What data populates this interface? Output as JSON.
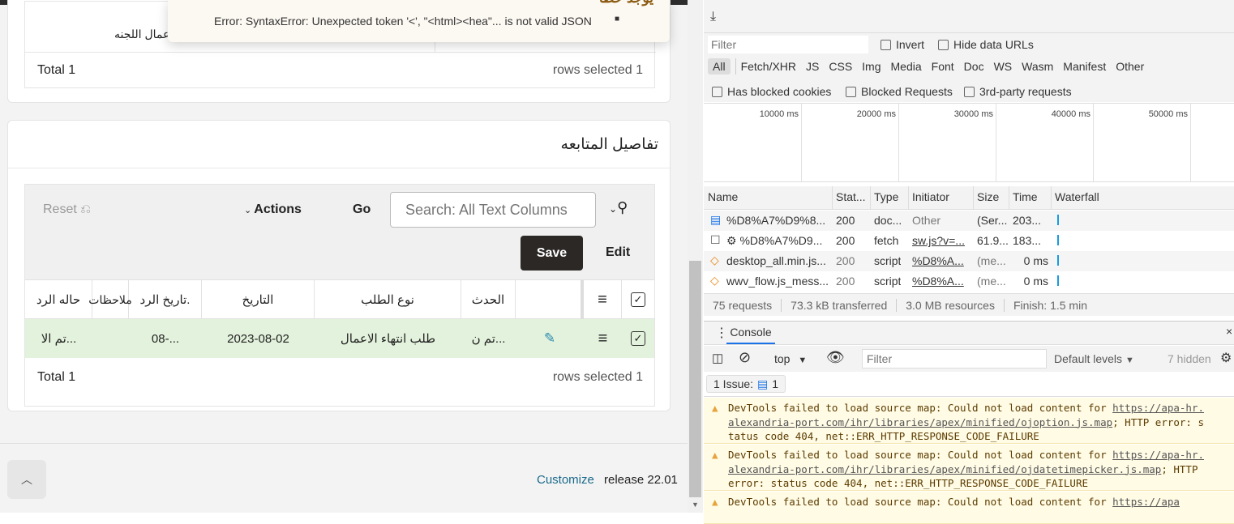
{
  "toast": {
    "title": "يوجد خطأ",
    "message": "Error: SyntaxError: Unexpected token '<', \"<html><hea\"... is not valid JSON"
  },
  "top_region": {
    "cell_text": "اعمال اللجنه",
    "total": "Total 1",
    "rows_selected": "rows selected 1"
  },
  "followup": {
    "title": "تفاصيل المتابعه",
    "search_placeholder": "Search: All Text Columns",
    "go": "Go",
    "actions": "Actions",
    "reset": "Reset",
    "save": "Save",
    "edit": "Edit",
    "columns": [
      "الحدث",
      "نوع الطلب",
      "التاريخ",
      "تاريخ الرد.",
      "ملاحظات",
      "حاله الرد"
    ],
    "row": {
      "event": "تم ن...",
      "request_type": "طلب انتهاء الاعمال",
      "date": "2023-08-02",
      "reply_date": "08-...",
      "notes": "",
      "reply_status": "تم الا..."
    },
    "total": "Total 1",
    "rows_selected": "rows selected 1"
  },
  "footer": {
    "customize": "Customize",
    "release": "release 22.01"
  },
  "devtools": {
    "filter_placeholder": "Filter",
    "invert": "Invert",
    "hide_data_urls": "Hide data URLs",
    "types": [
      "All",
      "Fetch/XHR",
      "JS",
      "CSS",
      "Img",
      "Media",
      "Font",
      "Doc",
      "WS",
      "Wasm",
      "Manifest",
      "Other"
    ],
    "has_blocked_cookies": "Has blocked cookies",
    "blocked_requests": "Blocked Requests",
    "third_party": "3rd-party requests",
    "timeline": [
      "10000 ms",
      "20000 ms",
      "30000 ms",
      "40000 ms",
      "50000 ms"
    ],
    "headers": [
      "Name",
      "Stat...",
      "Type",
      "Initiator",
      "Size",
      "Time",
      "Waterfall"
    ],
    "requests": [
      {
        "name": "%D8%A7%D9%8...",
        "status": "200",
        "type": "doc...",
        "initiator": "Other",
        "size": "(Ser...",
        "time": "203..."
      },
      {
        "name": "⚙ %D8%A7%D9...",
        "status": "200",
        "type": "fetch",
        "initiator": "sw.js?v=...",
        "size": "61.9...",
        "time": "183..."
      },
      {
        "name": "desktop_all.min.js...",
        "status": "200",
        "type": "script",
        "initiator": "%D8%A...",
        "size": "(me...",
        "time": "0 ms"
      },
      {
        "name": "wwv_flow.js_mess...",
        "status": "200",
        "type": "script",
        "initiator": "%D8%A...",
        "size": "(me...",
        "time": "0 ms"
      }
    ],
    "summary": [
      "75 requests",
      "73.3 kB transferred",
      "3.0 MB resources",
      "Finish: 1.5 min"
    ],
    "console_tab": "Console",
    "context": "top",
    "console_filter": "Filter",
    "levels": "Default levels",
    "hidden": "7 hidden",
    "issues_label": "1 Issue:",
    "issues_count": "1",
    "messages": [
      {
        "text": "DevTools failed to load source map: Could not load content for ",
        "link": "https://apa-hr.alexandria-port.com/ihr/libraries/apex/minified/ojoption.js.map",
        "tail": "; HTTP error: status code 404, net::ERR_HTTP_RESPONSE_CODE_FAILURE"
      },
      {
        "text": "DevTools failed to load source map: Could not load content for ",
        "link": "https://apa-hr.alexandria-port.com/ihr/libraries/apex/minified/ojdatetimepicker.js.map",
        "tail": "; HTTP error: status code 404, net::ERR_HTTP_RESPONSE_CODE_FAILURE"
      },
      {
        "text": "DevTools failed to load source map: Could not load content for ",
        "link": "https://apa",
        "tail": ""
      }
    ]
  }
}
